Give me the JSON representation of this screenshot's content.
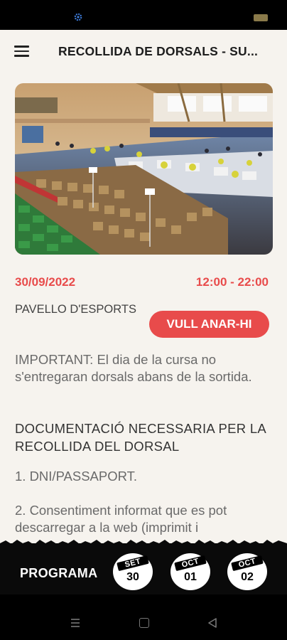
{
  "status_bar": {
    "gear_icon": "gear-icon",
    "battery_icon": "battery-icon"
  },
  "header": {
    "menu_icon": "hamburger-menu-icon",
    "title": "RECOLLIDA DE DORSALS - SU..."
  },
  "event": {
    "image_icon": "sports-hall-photo",
    "date": "30/09/2022",
    "time": "12:00 - 22:00",
    "venue": "PAVELLO D'ESPORTS",
    "cta_label": "VULL ANAR-HI",
    "accent_color": "#e84b4b"
  },
  "content": {
    "important": "IMPORTANT: El dia de la cursa no s'entregaran dorsals abans de la sortida.",
    "doc_heading": "DOCUMENTACIÓ NECESSARIA PER LA RECOLLIDA DEL DORSAL",
    "items": [
      "1. DNI/PASSAPORT.",
      "2. Consentiment informat que es pot descarregar a la web (imprimit i"
    ]
  },
  "bottom": {
    "programa_label": "PROGRAMA",
    "days": [
      {
        "month": "SET",
        "day": "30"
      },
      {
        "month": "OCT",
        "day": "01"
      },
      {
        "month": "OCT",
        "day": "02"
      }
    ]
  },
  "nav": {
    "recent_icon": "recent-apps-icon",
    "home_icon": "home-icon",
    "back_icon": "back-icon"
  }
}
